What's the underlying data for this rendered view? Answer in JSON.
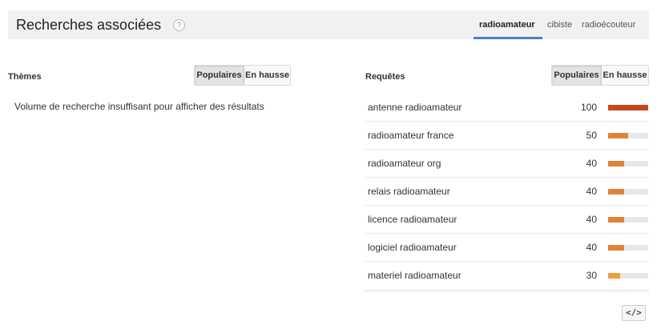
{
  "header": {
    "title": "Recherches associées",
    "help_icon": "?",
    "tabs": [
      {
        "label": "radioamateur",
        "active": true
      },
      {
        "label": "cibiste",
        "active": false
      },
      {
        "label": "radioécouteur",
        "active": false
      }
    ],
    "accent_color": "#4a7fc9"
  },
  "themes": {
    "label": "Thèmes",
    "toggle": {
      "popular": "Populaires",
      "rising": "En hausse",
      "selected": "Populaires"
    },
    "empty_message": "Volume de recherche insuffisant pour afficher des résultats"
  },
  "queries": {
    "label": "Requêtes",
    "toggle": {
      "popular": "Populaires",
      "rising": "En hausse",
      "selected": "Populaires"
    },
    "rows": [
      {
        "query": "antenne radioamateur",
        "value": "100",
        "level": 1.0,
        "color": "#c8461a"
      },
      {
        "query": "radioamateur france",
        "value": "50",
        "level": 0.5,
        "color": "#e0823a"
      },
      {
        "query": "radioamateur org",
        "value": "40",
        "level": 0.4,
        "color": "#e0823a"
      },
      {
        "query": "relais radioamateur",
        "value": "40",
        "level": 0.4,
        "color": "#e0823a"
      },
      {
        "query": "licence radioamateur",
        "value": "40",
        "level": 0.4,
        "color": "#e0823a"
      },
      {
        "query": "logiciel radioamateur",
        "value": "40",
        "level": 0.4,
        "color": "#e0823a"
      },
      {
        "query": "materiel radioamateur",
        "value": "30",
        "level": 0.3,
        "color": "#eaa040"
      }
    ]
  },
  "embed": {
    "label": "</>",
    "icon": "embed-code-icon"
  }
}
